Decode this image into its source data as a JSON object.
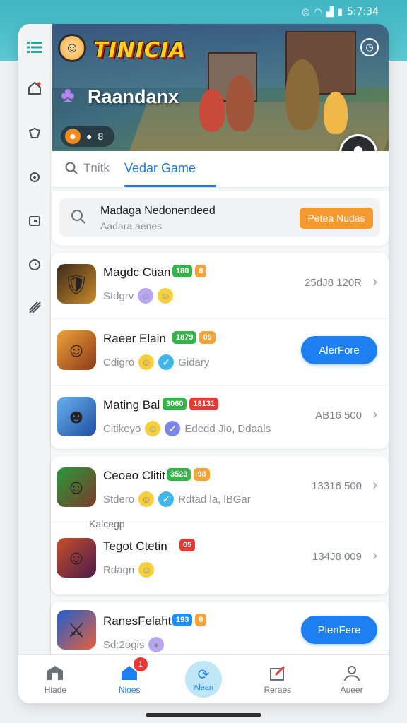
{
  "status_bar": {
    "time": "5:7:34",
    "icons": [
      "notification-icon",
      "wifi-icon",
      "signal-icon",
      "battery-icon"
    ]
  },
  "sidebar": {
    "items": [
      {
        "icon": "menu-icon"
      },
      {
        "icon": "home-icon"
      },
      {
        "icon": "tag-icon"
      },
      {
        "icon": "gear-icon"
      },
      {
        "icon": "wallet-icon"
      },
      {
        "icon": "compass-icon"
      },
      {
        "icon": "tools-icon"
      }
    ]
  },
  "banner": {
    "logo_title": "TINICIA",
    "game_name": "Raandanx",
    "chip_text": "8",
    "colors": {
      "title": "#ffd21f",
      "title_shadow": "#b02a0d"
    }
  },
  "tabs": {
    "search_tab_label": "Tnitk",
    "active_tab_label": "Vedar Game"
  },
  "search": {
    "title": "Madaga Nedonendeed",
    "subtitle": "Aadara aenes",
    "button_label": "Petea Nudas"
  },
  "list_group_1": [
    {
      "title": "Magdc Ctian",
      "tags": [
        {
          "text": "180",
          "color": "#35b24a"
        },
        {
          "text": "8",
          "color": "#f4a23a"
        }
      ],
      "sub": "Stdgrv",
      "sub_extra": "",
      "value": "25dJ8 120R",
      "action": "chevron"
    },
    {
      "title": "Raeer Elain",
      "tags": [
        {
          "text": "1879",
          "color": "#35b24a"
        },
        {
          "text": "09",
          "color": "#f4a23a"
        }
      ],
      "sub": "Cdigro",
      "sub_extra": "Gidary",
      "value": "",
      "action": "button",
      "button_label": "AlerFore"
    },
    {
      "title": "Mating Bal",
      "tags": [
        {
          "text": "3060",
          "color": "#35b24a"
        },
        {
          "text": "18131",
          "color": "#e53935"
        }
      ],
      "sub": "Citikeyo",
      "sub_extra": "Ededd Jio, Ddaals",
      "value": "AB16 500",
      "action": "chevron"
    }
  ],
  "list_group_2": [
    {
      "title": "Ceoeo Clitit",
      "tags": [
        {
          "text": "3523",
          "color": "#35b24a"
        },
        {
          "text": "98",
          "color": "#f4a23a"
        }
      ],
      "sub": "Stdero",
      "sub_extra": "Rdtad la, lBGar",
      "value": "13316 500",
      "action": "chevron"
    },
    {
      "title": "Tegot Ctetin",
      "tags": [
        {
          "text": "05",
          "color": "#e53935"
        }
      ],
      "sub": "Rdagn",
      "sub_extra": "",
      "value": "134J8 009",
      "action": "chevron"
    }
  ],
  "list_group_2_label": "Kalcegp",
  "list_group_3": [
    {
      "title": "RanesFelaht",
      "tags": [
        {
          "text": "193",
          "color": "#1e90ff"
        },
        {
          "text": "8",
          "color": "#f4a23a"
        }
      ],
      "sub": "Sd:2ogis",
      "sub_extra": "",
      "value": "",
      "action": "button",
      "button_label": "PlenFere"
    }
  ],
  "bottom_nav": {
    "items": [
      {
        "label": "Hiade",
        "icon": "shop-icon"
      },
      {
        "label": "Nioes",
        "icon": "home-icon",
        "badge": "1"
      },
      {
        "label": "Alean",
        "icon": "refresh-icon"
      },
      {
        "label": "Reraes",
        "icon": "edit-icon"
      },
      {
        "label": "Aueer",
        "icon": "profile-icon"
      }
    ]
  }
}
